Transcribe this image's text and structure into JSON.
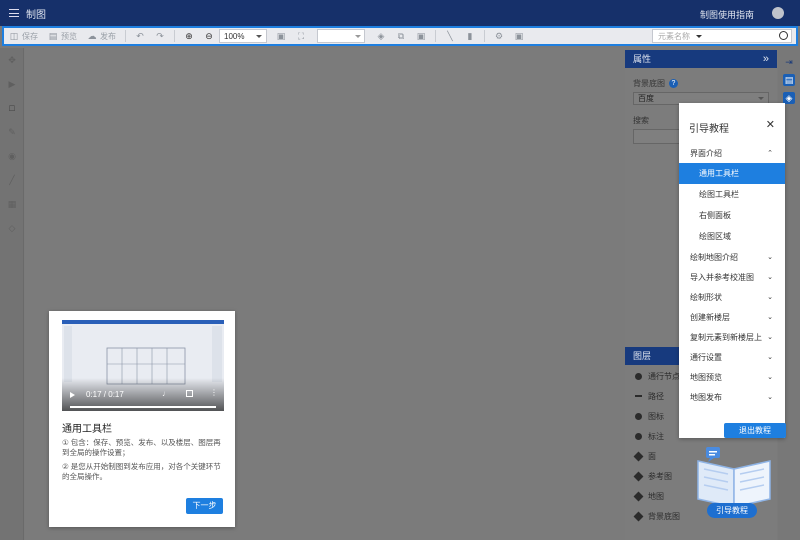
{
  "topbar": {
    "title": "制图",
    "guide_link": "制图使用指南"
  },
  "toolbar": {
    "save": "保存",
    "preview": "预览",
    "publish": "发布",
    "zoom": "100%",
    "element_search_placeholder": "元素名称"
  },
  "properties": {
    "header": "属性",
    "background_label": "背景底图",
    "background_value": "百度",
    "search_label": "搜索"
  },
  "layers": {
    "header": "图层",
    "items": [
      "通行节点",
      "路径",
      "图标",
      "标注",
      "面",
      "参考图",
      "地图",
      "背景底图"
    ]
  },
  "guide": {
    "title": "引导教程",
    "sections": [
      {
        "label": "界面介绍",
        "expanded": true
      },
      {
        "label": "绘制地图介绍"
      },
      {
        "label": "导入并参考校准图"
      },
      {
        "label": "绘制形状"
      },
      {
        "label": "创建新楼层"
      },
      {
        "label": "复制元素到新楼层上"
      },
      {
        "label": "通行设置"
      },
      {
        "label": "地图预览"
      },
      {
        "label": "地图发布"
      }
    ],
    "subitems": [
      "通用工具栏",
      "绘图工具栏",
      "右侧面板",
      "绘图区域"
    ],
    "active_subitem": "通用工具栏",
    "exit_button": "退出教程",
    "badge_label": "引导教程"
  },
  "tutorial_card": {
    "video_time": "0:17 / 0:17",
    "title": "通用工具栏",
    "line1": "① 包含：保存、预览、发布、以及楼层、图层再到全局的操作设置；",
    "line2": "② 是您从开始制图到发布应用，对各个关键环节的全局操作。",
    "next_button": "下一步"
  },
  "colors": {
    "topbar": "#16306a",
    "accent": "#1e7fe0",
    "panel_header": "#173a7e"
  }
}
